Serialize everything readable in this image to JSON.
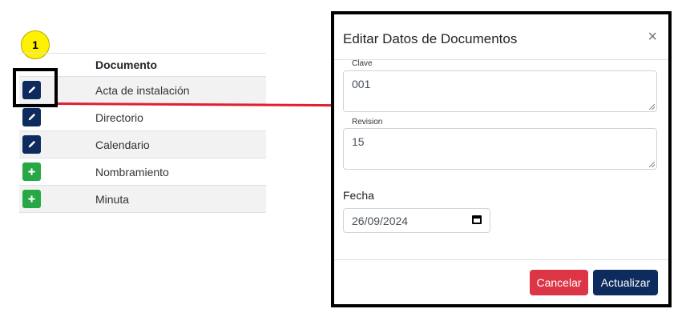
{
  "annotation": {
    "step": "1"
  },
  "table": {
    "header": "Documento",
    "rows": [
      {
        "name": "Acta de instalación",
        "action": "edit"
      },
      {
        "name": "Directorio",
        "action": "edit"
      },
      {
        "name": "Calendario",
        "action": "edit"
      },
      {
        "name": "Nombramiento",
        "action": "add"
      },
      {
        "name": "Minuta",
        "action": "add"
      }
    ],
    "icons": {
      "edit": "pencil-icon",
      "add": "plus-icon"
    }
  },
  "modal": {
    "title": "Editar Datos de Documentos",
    "close_label": "×",
    "fields": {
      "clave": {
        "label": "Clave",
        "value": "001"
      },
      "revision": {
        "label": "Revision",
        "value": "15"
      },
      "fecha": {
        "label": "Fecha",
        "value": "26/09/2024"
      }
    },
    "buttons": {
      "cancel": "Cancelar",
      "update": "Actualizar"
    }
  },
  "colors": {
    "edit_button": "#0d2b5c",
    "add_button": "#28a745",
    "cancel_button": "#dc3545",
    "update_button": "#0d2b5c",
    "connector": "#e02030",
    "callout": "#fff200"
  }
}
